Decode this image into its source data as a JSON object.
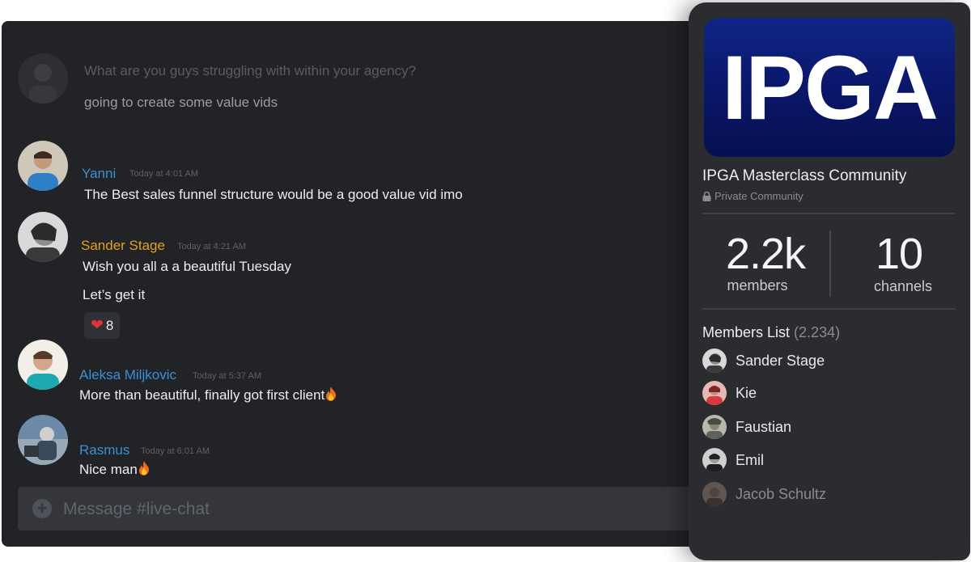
{
  "chat": {
    "messages": [
      {
        "name": "",
        "time": "",
        "lines": [
          "What are you guys struggling with within your agency?",
          "going to create some value vids"
        ]
      },
      {
        "name": "Yanni",
        "name_color": "#3d8fd6",
        "time": "Today at 4:01 AM",
        "lines": [
          "The Best sales funnel structure would be a good value vid imo"
        ]
      },
      {
        "name": "Sander Stage",
        "name_color": "#e0a21c",
        "time": "Today at 4:21 AM",
        "lines": [
          "Wish you all a a beautiful Tuesday",
          "Let’s get it"
        ],
        "reaction": {
          "icon": "heart-icon",
          "count": "8"
        }
      },
      {
        "name": "Aleksa Miljkovic",
        "name_color": "#3d8fd6",
        "time": "Today at 5:37 AM",
        "lines": [
          "More than beautiful, finally got first client"
        ]
      },
      {
        "name": "Rasmus",
        "name_color": "#3d8fd6",
        "time": "Today at 6:01 AM",
        "lines": [
          "Nice man"
        ]
      }
    ],
    "composer": {
      "placeholder": "Message #live-chat"
    }
  },
  "community": {
    "banner_text": "IPGA",
    "banner_color": "#0a1668",
    "title": "IPGA Masterclass Community",
    "privacy": "Private Community",
    "stats": [
      {
        "value": "2.2k",
        "label": "members"
      },
      {
        "value": "10",
        "label": "channels"
      }
    ],
    "members_heading": "Members List",
    "members_count": "(2.234)",
    "members": [
      {
        "name": "Sander Stage"
      },
      {
        "name": "Kie"
      },
      {
        "name": "Faustian"
      },
      {
        "name": "Emil"
      },
      {
        "name": "Jacob Schultz"
      }
    ]
  }
}
